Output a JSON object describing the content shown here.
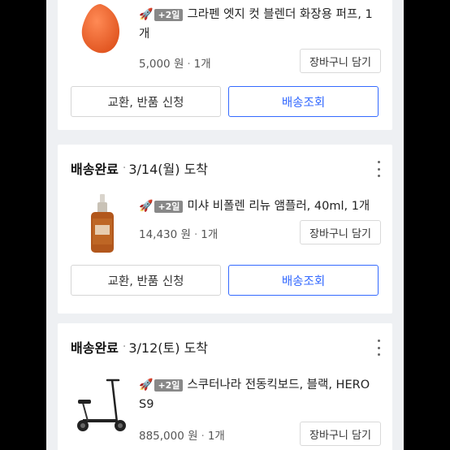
{
  "orders": [
    {
      "product_name": "그라펜 엣지 컷 블렌더 화장용 퍼프, 1개",
      "badge": "+2일",
      "price": "5,000 원",
      "quantity": "1개",
      "cart_label": "장바구니 담기",
      "exchange_label": "교환, 반품 신청",
      "track_label": "배송조회"
    },
    {
      "status": "배송완료",
      "arrival": "3/14(월) 도착",
      "product_name": "미샤 비폴렌 리뉴 앰플러, 40ml, 1개",
      "badge": "+2일",
      "price": "14,430 원",
      "quantity": "1개",
      "cart_label": "장바구니 담기",
      "exchange_label": "교환, 반품 신청",
      "track_label": "배송조회"
    },
    {
      "status": "배송완료",
      "arrival": "3/12(토) 도착",
      "product_name": "스쿠터나라 전동킥보드, 블랙, HERO S9",
      "badge": "+2일",
      "price": "885,000 원",
      "quantity": "1개",
      "cart_label": "장바구니 담기"
    }
  ],
  "icons": {
    "rocket": "rocket-icon",
    "kebab": "more-vertical-icon"
  },
  "colors": {
    "accent": "#346aff",
    "badge": "#888888",
    "background": "#eef0f3"
  }
}
